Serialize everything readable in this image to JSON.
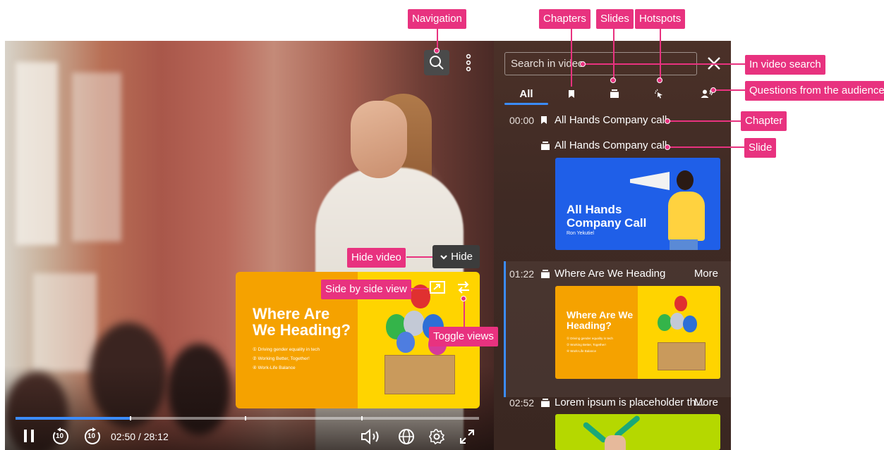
{
  "player": {
    "pip_slide": {
      "title": "Where Are We Heading?",
      "bullets": [
        "Driving gender equality in tech",
        "Working Better, Together!",
        "Work-Life Balance"
      ],
      "bullet_numbers": [
        "1",
        "2",
        "3"
      ]
    },
    "hide_label": "Hide",
    "time_readout": "02:50 / 28:12",
    "progress_fraction": 0.25,
    "skip_back_label": "10",
    "skip_forward_label": "10"
  },
  "panel": {
    "search": {
      "placeholder": "Search in video"
    },
    "tabs": [
      {
        "label": "All",
        "active": true
      },
      {
        "label": "",
        "icon": "bookmark-icon"
      },
      {
        "label": "",
        "icon": "slides-icon"
      },
      {
        "label": "",
        "icon": "hotspot-icon"
      },
      {
        "label": "",
        "icon": "audience-questions-icon"
      }
    ],
    "entries": [
      {
        "time": "00:00",
        "icon": "bookmark-icon",
        "title": "All Hands Company call"
      },
      {
        "time": "",
        "icon": "slides-icon",
        "title": "All Hands Company call",
        "thumb": {
          "title": "All Hands Company Call",
          "subtitle": "Ron Yekutiel"
        }
      },
      {
        "time": "01:22",
        "icon": "slides-icon",
        "title": "Where Are We Heading",
        "more": "More",
        "thumb": {
          "title": "Where Are We Heading?",
          "bullets": [
            "Driving gender equality in tech",
            "Working Better, Together!",
            "Work-Life Balance"
          ]
        }
      },
      {
        "time": "02:52",
        "icon": "slides-icon",
        "title": "Lorem ipsum is placeholder th...",
        "more": "More"
      }
    ]
  },
  "callouts": {
    "navigation": "Navigation",
    "chapters": "Chapters",
    "slides": "Slides",
    "hotspots": "Hotspots",
    "in_video_search": "In video search",
    "questions": "Questions from the audience",
    "chapter": "Chapter",
    "slide": "Slide",
    "hide_video": "Hide video",
    "side_by_side": "Side by side view",
    "toggle_views": "Toggle views"
  },
  "colors": {
    "accent": "#3b8cff",
    "callout": "#e8327f",
    "slide_orange": "#f5a200",
    "slide_yellow": "#ffd400",
    "slide_blue": "#1f5fe8",
    "slide_green": "#b5d800"
  }
}
